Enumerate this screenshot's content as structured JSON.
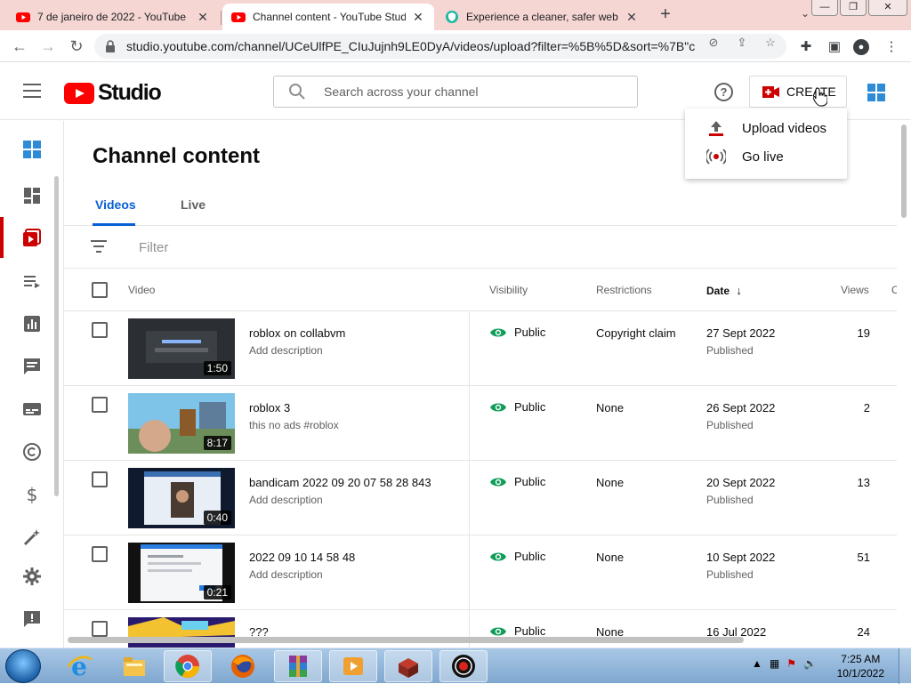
{
  "browser": {
    "tabs": [
      {
        "label": "7 de janeiro de 2022 - YouTube",
        "active": false
      },
      {
        "label": "Channel content - YouTube Studi",
        "active": true
      },
      {
        "label": "Experience a cleaner, safer web",
        "active": false
      }
    ],
    "url": "studio.youtube.com/channel/UCeUlfPE_CIuJujnh9LE0DyA/videos/upload?filter=%5B%5D&sort=%7B\"c..."
  },
  "header": {
    "logo_text": "Studio",
    "search_placeholder": "Search across your channel",
    "help_glyph": "?",
    "create_label": "CREATE"
  },
  "create_menu": {
    "items": [
      {
        "label": "Upload videos",
        "icon": "upload-icon"
      },
      {
        "label": "Go live",
        "icon": "go-live-icon"
      }
    ]
  },
  "page": {
    "title": "Channel content",
    "tabs": [
      "Videos",
      "Live"
    ],
    "active_tab": "Videos",
    "filter_placeholder": "Filter"
  },
  "table": {
    "headers": {
      "video": "Video",
      "visibility": "Visibility",
      "restrictions": "Restrictions",
      "date": "Date",
      "views": "Views",
      "comments": "C"
    },
    "rows": [
      {
        "title": "roblox on collabvm",
        "description": "Add description",
        "duration": "1:50",
        "visibility": "Public",
        "restrictions": "Copyright claim",
        "date": "27 Sept 2022",
        "status": "Published",
        "views": "19"
      },
      {
        "title": "roblox 3",
        "description": "this no ads #roblox",
        "duration": "8:17",
        "visibility": "Public",
        "restrictions": "None",
        "date": "26 Sept 2022",
        "status": "Published",
        "views": "2"
      },
      {
        "title": "bandicam 2022 09 20 07 58 28 843",
        "description": "Add description",
        "duration": "0:40",
        "visibility": "Public",
        "restrictions": "None",
        "date": "20 Sept 2022",
        "status": "Published",
        "views": "13"
      },
      {
        "title": "2022 09 10 14 58 48",
        "description": "Add description",
        "duration": "0:21",
        "visibility": "Public",
        "restrictions": "None",
        "date": "10 Sept 2022",
        "status": "Published",
        "views": "51"
      },
      {
        "title": "???",
        "description": "",
        "duration": "",
        "visibility": "Public",
        "restrictions": "None",
        "date": "16 Jul 2022",
        "status": "",
        "views": "24"
      }
    ]
  },
  "taskbar": {
    "time": "7:25 AM",
    "date": "10/1/2022"
  },
  "colors": {
    "accent_blue": "#065fd4",
    "youtube_red": "#ff0000",
    "public_green": "#0f9d58",
    "tab_strip": "#f5d6d3"
  }
}
